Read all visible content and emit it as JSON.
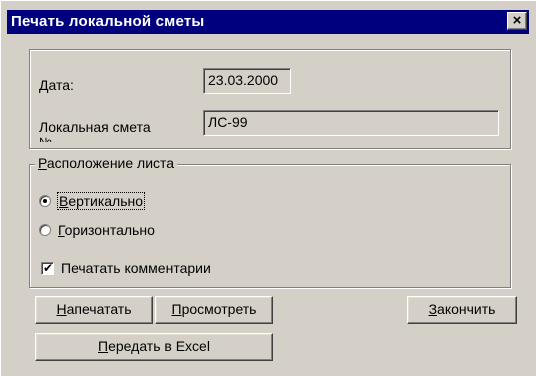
{
  "window": {
    "title": "Печать локальной сметы",
    "close_symbol": "×"
  },
  "fields": {
    "date_label": "Дата:",
    "date_value": "23.03.2000",
    "estimate_label": "Локальная смета",
    "estimate_label_cut": "№",
    "estimate_value": "ЛС-99"
  },
  "layout_group": {
    "legend_first": "Р",
    "legend_rest": "асположение листа",
    "options": [
      {
        "first": "В",
        "rest": "ертикально",
        "selected": true
      },
      {
        "first": "Г",
        "rest": "оризонтально",
        "selected": false
      }
    ],
    "comments_label": "Печатать комментарии",
    "comments_checked": true,
    "check_symbol": "✔"
  },
  "buttons": {
    "print_first": "Н",
    "print_rest": "апечатать",
    "preview_first": "П",
    "preview_rest": "росмотреть",
    "finish_first": "З",
    "finish_rest": "акончить",
    "excel_first": "П",
    "excel_rest": "ередать в Excel"
  }
}
